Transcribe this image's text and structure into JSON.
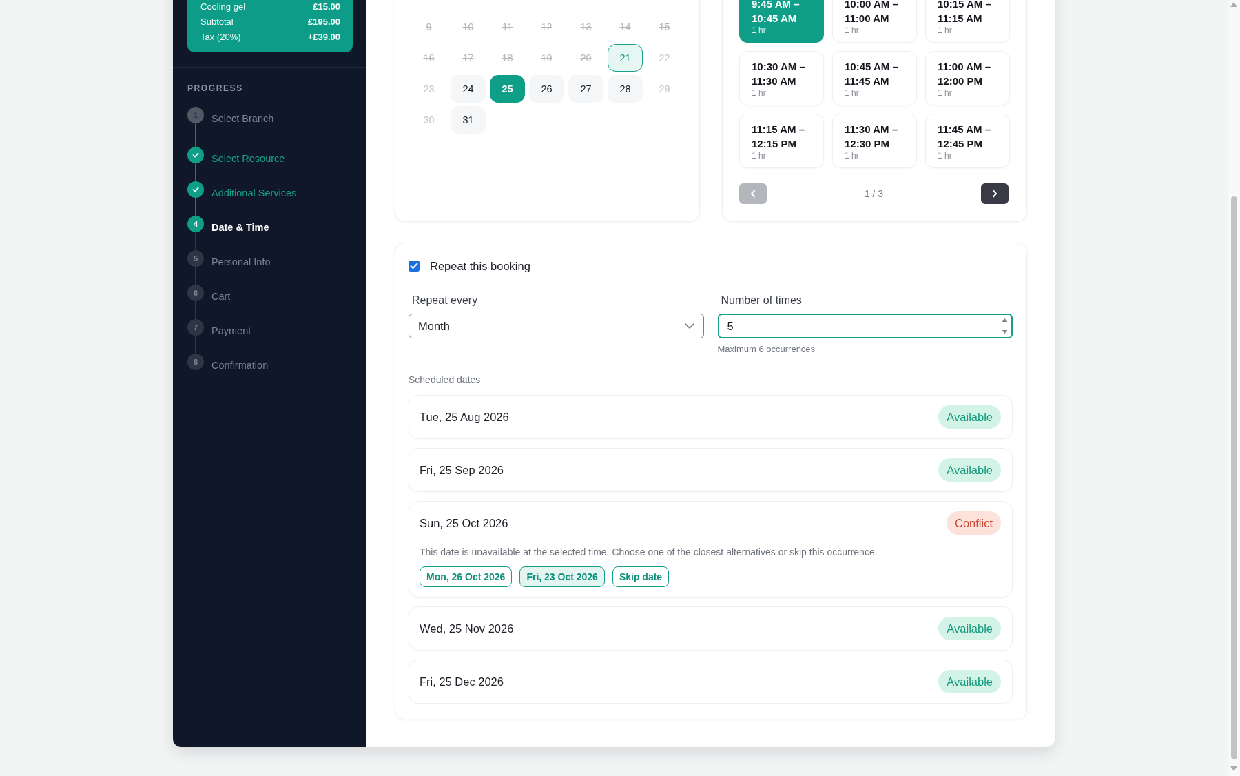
{
  "summary": {
    "lines": [
      {
        "label": "Cooling gel",
        "amount": "£15.00"
      },
      {
        "label": "Subtotal",
        "amount": "£195.00"
      },
      {
        "label": "Tax (20%)",
        "amount": "+£39.00"
      }
    ]
  },
  "progress": {
    "title": "PROGRESS",
    "steps": [
      {
        "number": "1",
        "label": "Select Branch",
        "completed": false,
        "current": false,
        "disabled": true
      },
      {
        "label": "Select Resource",
        "completed": true,
        "current": false,
        "disabled": false
      },
      {
        "label": "Additional Services",
        "completed": true,
        "current": false,
        "disabled": false
      },
      {
        "number": "4",
        "label": "Date & Time",
        "completed": false,
        "current": true,
        "disabled": false
      },
      {
        "number": "5",
        "label": "Personal Info",
        "completed": false,
        "current": false,
        "disabled": false
      },
      {
        "number": "6",
        "label": "Cart",
        "completed": false,
        "current": false,
        "disabled": false
      },
      {
        "number": "7",
        "label": "Payment",
        "completed": false,
        "current": false,
        "disabled": false
      },
      {
        "number": "8",
        "label": "Confirmation",
        "completed": false,
        "current": false,
        "disabled": false
      }
    ]
  },
  "calendar": {
    "days": [
      {
        "day": "9",
        "kind": "past",
        "selected": false
      },
      {
        "day": "10",
        "kind": "past",
        "selected": false
      },
      {
        "day": "11",
        "kind": "past",
        "selected": false
      },
      {
        "day": "12",
        "kind": "past",
        "selected": false
      },
      {
        "day": "13",
        "kind": "past",
        "selected": false
      },
      {
        "day": "14",
        "kind": "past",
        "selected": false
      },
      {
        "day": "15",
        "kind": "past",
        "selected": false
      },
      {
        "day": "16",
        "kind": "past",
        "selected": false
      },
      {
        "day": "17",
        "kind": "past",
        "selected": false
      },
      {
        "day": "18",
        "kind": "past",
        "selected": false
      },
      {
        "day": "19",
        "kind": "past",
        "selected": false
      },
      {
        "day": "20",
        "kind": "past",
        "selected": false
      },
      {
        "day": "21",
        "kind": "today",
        "selected": false
      },
      {
        "day": "22",
        "kind": "closed",
        "selected": false
      },
      {
        "day": "23",
        "kind": "closed",
        "selected": false
      },
      {
        "day": "24",
        "kind": "open",
        "selected": false
      },
      {
        "day": "25",
        "kind": "open",
        "selected": true
      },
      {
        "day": "26",
        "kind": "open",
        "selected": false
      },
      {
        "day": "27",
        "kind": "open",
        "selected": false
      },
      {
        "day": "28",
        "kind": "open",
        "selected": false
      },
      {
        "day": "29",
        "kind": "closed",
        "selected": false
      },
      {
        "day": "30",
        "kind": "closed",
        "selected": false
      },
      {
        "day": "31",
        "kind": "open",
        "selected": false
      }
    ]
  },
  "time_slots": {
    "slots": [
      {
        "time": "9:45 AM – 10:45 AM",
        "duration": "1 hr",
        "selected": true
      },
      {
        "time": "10:00 AM – 11:00 AM",
        "duration": "1 hr",
        "selected": false
      },
      {
        "time": "10:15 AM – 11:15 AM",
        "duration": "1 hr",
        "selected": false
      },
      {
        "time": "10:30 AM – 11:30 AM",
        "duration": "1 hr",
        "selected": false
      },
      {
        "time": "10:45 AM – 11:45 AM",
        "duration": "1 hr",
        "selected": false
      },
      {
        "time": "11:00 AM – 12:00 PM",
        "duration": "1 hr",
        "selected": false
      },
      {
        "time": "11:15 AM – 12:15 PM",
        "duration": "1 hr",
        "selected": false
      },
      {
        "time": "11:30 AM – 12:30 PM",
        "duration": "1 hr",
        "selected": false
      },
      {
        "time": "11:45 AM – 12:45 PM",
        "duration": "1 hr",
        "selected": false
      }
    ],
    "pagination": {
      "page": "1 / 3",
      "prev": {
        "disabled": true
      },
      "next": {
        "disabled": false
      }
    }
  },
  "repeat": {
    "checkbox": {
      "label": "Repeat this booking",
      "checked": true
    },
    "repeat_every": {
      "label": "Repeat every",
      "value": "Month"
    },
    "number_of_times": {
      "label": "Number of times",
      "value": "5",
      "focused": true,
      "hint": "Maximum 6 occurrences"
    },
    "scheduled": {
      "title": "Scheduled dates",
      "dates": [
        {
          "date": "Tue, 25 Aug 2026",
          "status": "Available",
          "kind": "available"
        },
        {
          "date": "Fri, 25 Sep 2026",
          "status": "Available",
          "kind": "available"
        },
        {
          "date": "Sun, 25 Oct 2026",
          "status": "Conflict",
          "kind": "conflict",
          "message": "This date is unavailable at the selected time. Choose one of the closest alternatives or skip this occurrence.",
          "options": [
            {
              "label": "Mon, 26 Oct 2026",
              "selected": false
            },
            {
              "label": "Fri, 23 Oct 2026",
              "selected": true
            },
            {
              "label": "Skip date",
              "selected": false
            }
          ]
        },
        {
          "date": "Wed, 25 Nov 2026",
          "status": "Available",
          "kind": "available"
        },
        {
          "date": "Fri, 25 Dec 2026",
          "status": "Available",
          "kind": "available"
        }
      ]
    }
  }
}
